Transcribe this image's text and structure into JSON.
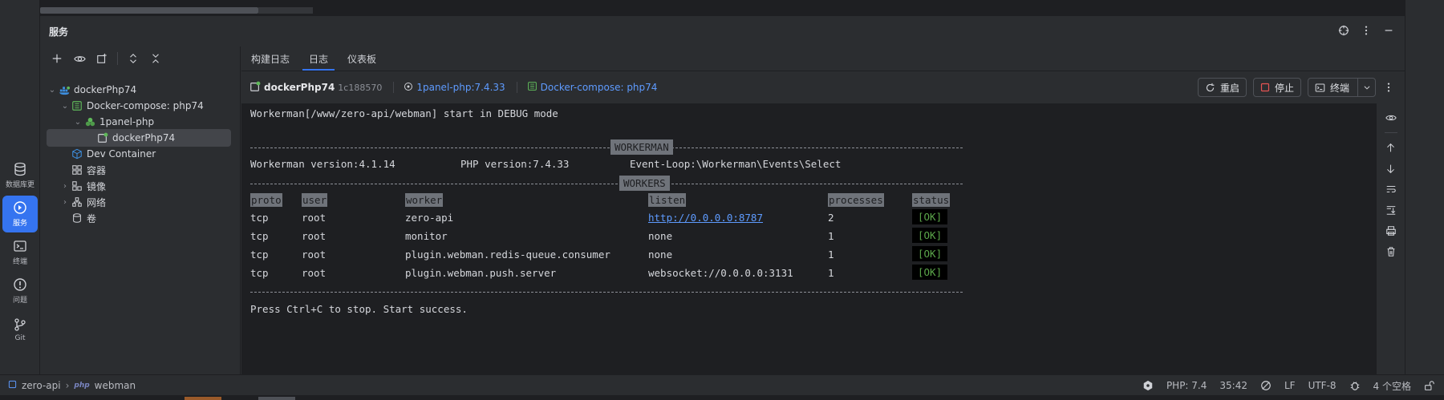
{
  "activity_bar": [
    {
      "label": "数据库更",
      "icon": "database-icon",
      "active": false
    },
    {
      "label": "服务",
      "icon": "services-icon",
      "active": true
    },
    {
      "label": "终端",
      "icon": "terminal-icon",
      "active": false
    },
    {
      "label": "问题",
      "icon": "problems-icon",
      "active": false
    },
    {
      "label": "Git",
      "icon": "git-branch-icon",
      "active": false
    }
  ],
  "toolwindow": {
    "title": "服务"
  },
  "tree": [
    {
      "label": "dockerPhp74",
      "icon": "docker-icon",
      "expanded": true,
      "depth": 0
    },
    {
      "label": "Docker-compose: php74",
      "icon": "compose-icon",
      "expanded": true,
      "depth": 1
    },
    {
      "label": "1panel-php",
      "icon": "service-icon",
      "expanded": true,
      "depth": 2
    },
    {
      "label": "dockerPhp74",
      "icon": "container-running-icon",
      "depth": 3,
      "selected": true
    },
    {
      "label": "Dev Container",
      "icon": "cube-icon",
      "depth": 1
    },
    {
      "label": "容器",
      "icon": "containers-icon",
      "depth": 1
    },
    {
      "label": "镜像",
      "icon": "images-icon",
      "depth": 1,
      "collapsed": true
    },
    {
      "label": "网络",
      "icon": "network-icon",
      "depth": 1,
      "collapsed": true
    },
    {
      "label": "卷",
      "icon": "volume-icon",
      "depth": 1
    }
  ],
  "tabs": [
    {
      "label": "构建日志"
    },
    {
      "label": "日志",
      "active": true
    },
    {
      "label": "仪表板"
    }
  ],
  "context": {
    "container_name": "dockerPhp74",
    "container_hash": "1c188570",
    "image": "1panel-php:7.4.33",
    "compose": "Docker-compose: php74"
  },
  "actions": {
    "restart": "重启",
    "stop": "停止",
    "terminal": "终端"
  },
  "console": {
    "line1": "Workerman[/www/zero-api/webman] start in DEBUG mode",
    "banner1": "WORKERMAN",
    "workerman_version": "Workerman version:4.1.14",
    "php_version": "PHP version:7.4.33",
    "event_loop": "Event-Loop:\\Workerman\\Events\\Select",
    "banner2": "WORKERS",
    "headers": [
      "proto",
      "user",
      "worker",
      "listen",
      "processes",
      "status"
    ],
    "rows": [
      {
        "proto": "tcp",
        "user": "root",
        "worker": "zero-api",
        "listen": "http://0.0.0.0:8787",
        "processes": "2",
        "status": "[OK]"
      },
      {
        "proto": "tcp",
        "user": "root",
        "worker": "monitor",
        "listen": "none",
        "processes": "1",
        "status": "[OK]"
      },
      {
        "proto": "tcp",
        "user": "root",
        "worker": "plugin.webman.redis-queue.consumer",
        "listen": "none",
        "processes": "1",
        "status": "[OK]"
      },
      {
        "proto": "tcp",
        "user": "root",
        "worker": "plugin.webman.push.server",
        "listen": "websocket://0.0.0.0:3131",
        "processes": "1",
        "status": "[OK]"
      }
    ],
    "last_line": "Press Ctrl+C to stop. Start success."
  },
  "statusbar": {
    "project": "zero-api",
    "php_badge": "php",
    "module": "webman",
    "php_level": "PHP: 7.4",
    "cursor": "35:42",
    "line_sep": "LF",
    "encoding": "UTF-8",
    "indent": "4 个空格"
  },
  "colors": {
    "accent": "#3574f0",
    "ok_green": "#5ba64a",
    "link": "#5e9bff",
    "stop_red": "#e55353",
    "running_green": "#5fb85a"
  }
}
